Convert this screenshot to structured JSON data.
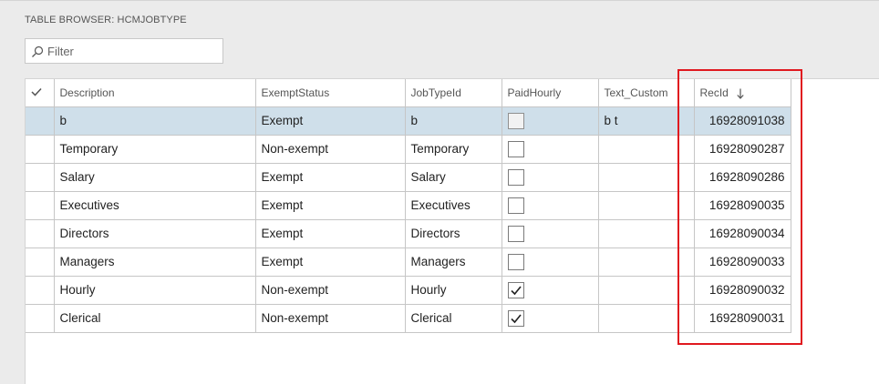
{
  "page": {
    "title": "TABLE BROWSER: HCMJOBTYPE"
  },
  "filter": {
    "placeholder": "Filter",
    "value": ""
  },
  "grid": {
    "columns": [
      {
        "key": "select",
        "label": ""
      },
      {
        "key": "description",
        "label": "Description"
      },
      {
        "key": "exempt_status",
        "label": "ExemptStatus"
      },
      {
        "key": "job_type_id",
        "label": "JobTypeId"
      },
      {
        "key": "paid_hourly",
        "label": "PaidHourly"
      },
      {
        "key": "text_custom",
        "label": "Text_Custom"
      },
      {
        "key": "rec_id",
        "label": "RecId",
        "sort": "descending"
      }
    ],
    "rows": [
      {
        "description": "b",
        "exempt_status": "Exempt",
        "job_type_id": "b",
        "paid_hourly": false,
        "text_custom": "b t",
        "rec_id": "16928091038",
        "selected": true
      },
      {
        "description": "Temporary",
        "exempt_status": "Non-exempt",
        "job_type_id": "Temporary",
        "paid_hourly": false,
        "text_custom": "",
        "rec_id": "16928090287"
      },
      {
        "description": "Salary",
        "exempt_status": "Exempt",
        "job_type_id": "Salary",
        "paid_hourly": false,
        "text_custom": "",
        "rec_id": "16928090286"
      },
      {
        "description": "Executives",
        "exempt_status": "Exempt",
        "job_type_id": "Executives",
        "paid_hourly": false,
        "text_custom": "",
        "rec_id": "16928090035"
      },
      {
        "description": "Directors",
        "exempt_status": "Exempt",
        "job_type_id": "Directors",
        "paid_hourly": false,
        "text_custom": "",
        "rec_id": "16928090034"
      },
      {
        "description": "Managers",
        "exempt_status": "Exempt",
        "job_type_id": "Managers",
        "paid_hourly": false,
        "text_custom": "",
        "rec_id": "16928090033"
      },
      {
        "description": "Hourly",
        "exempt_status": "Non-exempt",
        "job_type_id": "Hourly",
        "paid_hourly": true,
        "text_custom": "",
        "rec_id": "16928090032"
      },
      {
        "description": "Clerical",
        "exempt_status": "Non-exempt",
        "job_type_id": "Clerical",
        "paid_hourly": true,
        "text_custom": "",
        "rec_id": "16928090031"
      }
    ]
  },
  "colors": {
    "selected_row": "#cfdfea",
    "highlight_box": "#e0191f",
    "grid_border": "#c6c6c6"
  }
}
